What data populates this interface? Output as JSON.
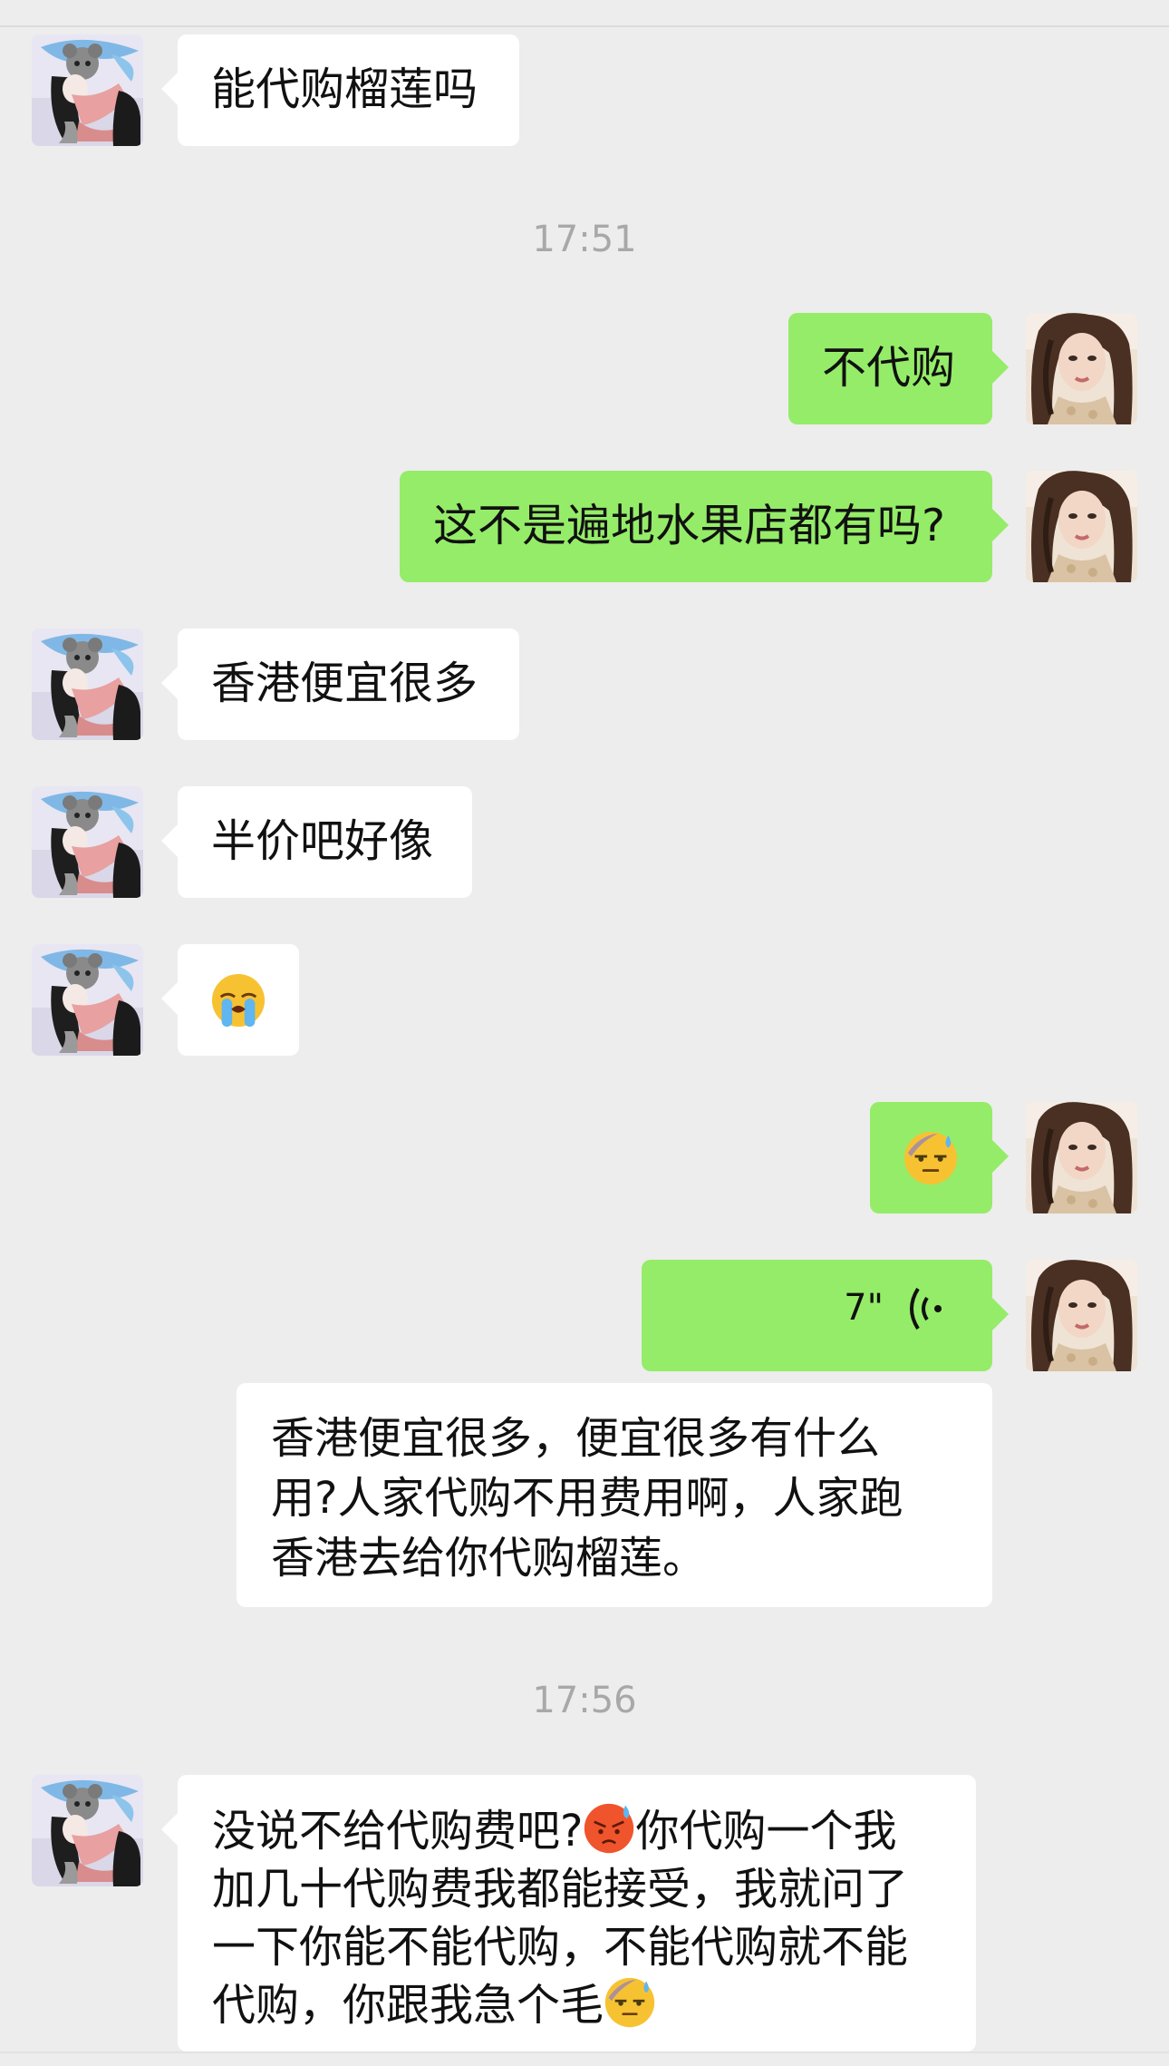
{
  "chat": {
    "timestamps": [
      "17:51",
      "17:56"
    ],
    "messages": [
      {
        "side": "in",
        "text": "能代购榴莲吗"
      },
      {
        "side": "out",
        "text": "不代购"
      },
      {
        "side": "out",
        "text": "这不是遍地水果店都有吗?"
      },
      {
        "side": "in",
        "text": "香港便宜很多"
      },
      {
        "side": "in",
        "text": "半价吧好像"
      },
      {
        "side": "in",
        "emoji": "crying-face-emoji"
      },
      {
        "side": "out",
        "emoji": "sweat-smile-emoji"
      },
      {
        "side": "out",
        "voice_duration": "7\""
      },
      {
        "side": "out",
        "transcript_lines": [
          "香港便宜很多，便宜很多有什么",
          "用?人家代购不用费用啊，人家跑",
          "香港去给你代购榴莲。"
        ]
      },
      {
        "side": "in",
        "long_text": {
          "line1a": "没说不给代购费吧?",
          "line1b": "你代购一个我",
          "line2": "加几十代购费我都能接受，我就问了",
          "line3": "一下你能不能代购，不能代购就不能",
          "line4": "代购，你跟我急个毛"
        }
      }
    ]
  },
  "colors": {
    "background": "#ededed",
    "incoming_bubble": "#ffffff",
    "outgoing_bubble": "#95ec69",
    "timestamp": "#a8a8a8"
  }
}
